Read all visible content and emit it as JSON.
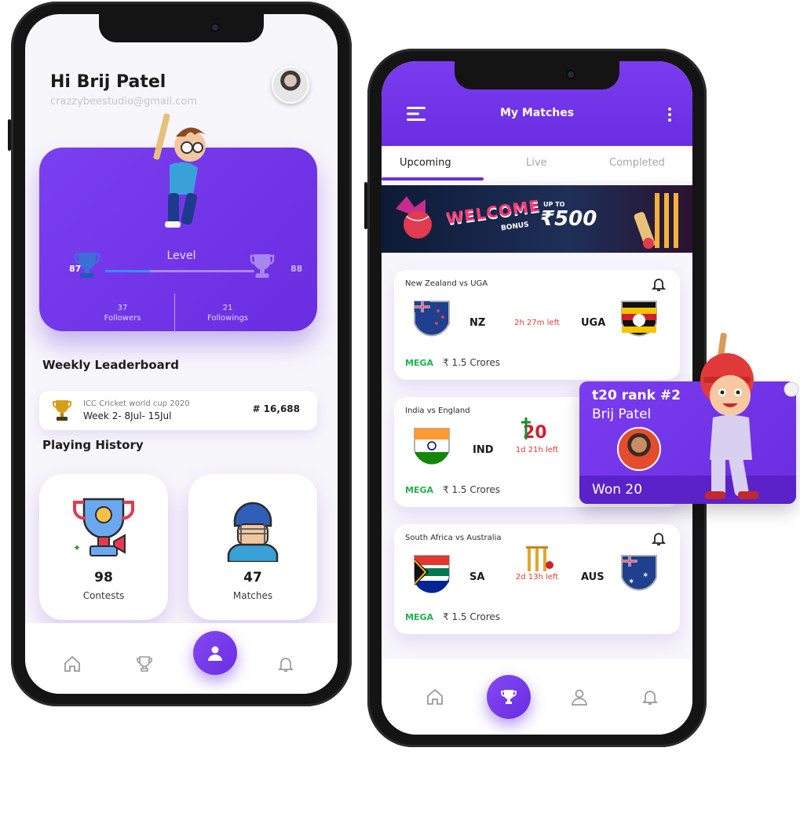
{
  "left_phone": {
    "greeting": "Hi Brij Patel",
    "email": "crazzybeestudio@gmail.com",
    "level": {
      "label": "Level",
      "current": "87",
      "next": "88",
      "progress_fraction": 0.3
    },
    "followers": {
      "count": "37",
      "label": "Followers"
    },
    "followings": {
      "count": "21",
      "label": "Followings"
    },
    "leaderboard": {
      "title": "Weekly Leaderboard",
      "tournament": "ICC Cricket world cup 2020",
      "week": "Week 2- 8Jul- 15Jul",
      "rank": "# 16,688"
    },
    "history": {
      "title": "Playing History",
      "contests": {
        "count": "98",
        "label": "Contests"
      },
      "matches": {
        "count": "47",
        "label": "Matches"
      }
    },
    "nav": [
      "home-icon",
      "trophy-icon",
      "user-icon",
      "bell-icon"
    ],
    "active_nav": "user-icon"
  },
  "right_phone": {
    "title": "My Matches",
    "tabs": [
      "Upcoming",
      "Live",
      "Completed"
    ],
    "active_tab": "Upcoming",
    "banner": {
      "welcome": "WELCOME",
      "bonus": "BONUS",
      "up_to": "UP TO",
      "amount": "₹500"
    },
    "matches": [
      {
        "title": "New Zealand vs UGA",
        "team1": "NZ",
        "team2": "UGA",
        "time_left": "2h 27m left",
        "mega": "MEGA",
        "prize": "₹ 1.5 Crores"
      },
      {
        "title": "India vs England",
        "team1": "IND",
        "team2": "",
        "time_left": "1d 21h left",
        "mega": "MEGA",
        "prize": "₹ 1.5 Crores"
      },
      {
        "title": "South Africa vs Australia",
        "team1": "SA",
        "team2": "AUS",
        "time_left": "2d 13h left",
        "mega": "MEGA",
        "prize": "₹ 1.5 Crores"
      }
    ],
    "nav": [
      "home-icon",
      "trophy-icon",
      "user-icon",
      "bell-icon"
    ],
    "active_nav": "trophy-icon"
  },
  "rank_popup": {
    "title": "t20 rank #2",
    "name": "Brij Patel",
    "result": "Won 20"
  },
  "colors": {
    "accent": "#6a2de0",
    "mega_green": "#20b24b",
    "time_red": "#e53935"
  }
}
